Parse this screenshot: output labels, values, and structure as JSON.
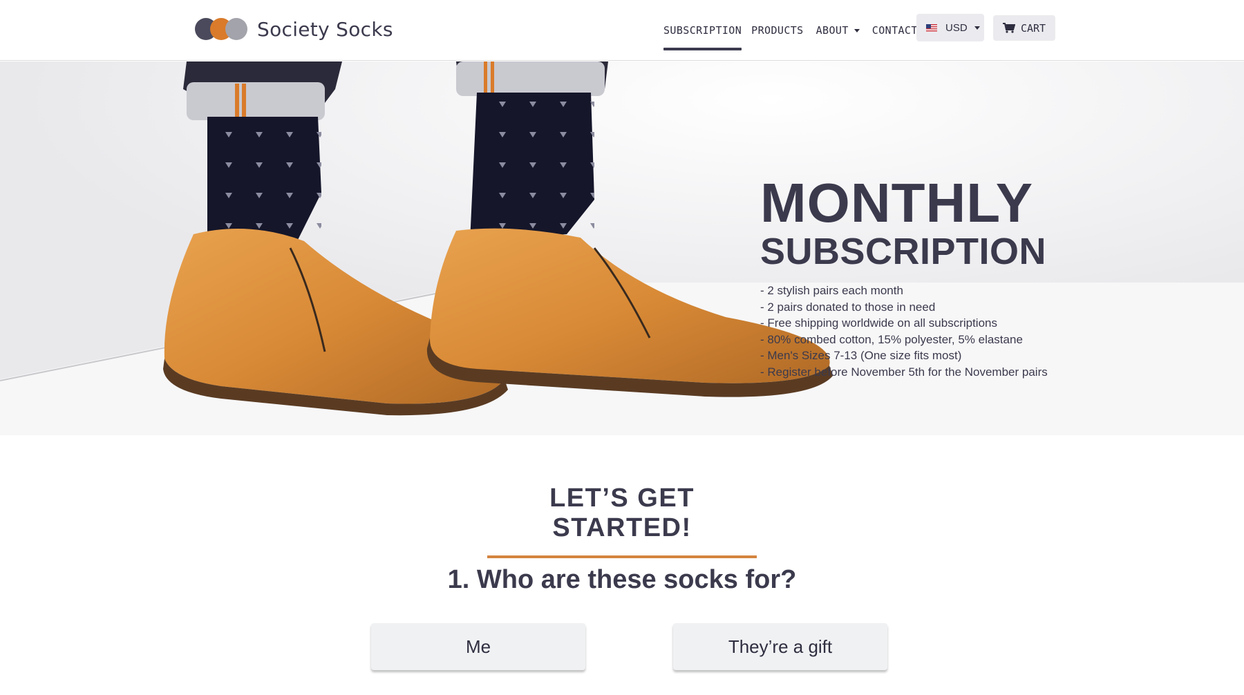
{
  "header": {
    "logo_text": "Society Socks",
    "logo_colors": [
      "#4a4a5c",
      "#d97b2a",
      "#a3a3ab"
    ],
    "nav": {
      "subscription": "SUBSCRIPTION",
      "products": "PRODUCTS",
      "about": "ABOUT",
      "contact": "CONTACT"
    },
    "currency": "USD",
    "currency_icon": "us-flag-icon",
    "cart_label": "CART",
    "cart_icon": "shopping-cart-icon"
  },
  "hero": {
    "title_line1": "MONTHLY",
    "title_line2": "SUBSCRIPTION",
    "features": [
      "- 2 stylish pairs each month",
      "- 2 pairs donated to those in need",
      "- Free shipping worldwide on all subscriptions",
      "- 80% combed cotton, 15% polyester, 5% elastane",
      "- Men's Sizes 7-13 (One size fits most)",
      "- Register before November 5th for the November pairs"
    ]
  },
  "section": {
    "heading": "LET’S GET STARTED!",
    "question": "1. Who are these socks for?",
    "options": [
      "Me",
      "They’re a gift"
    ]
  },
  "colors": {
    "accent": "#d4843f",
    "text": "#3b3a4d",
    "button_bg": "#f0f1f3"
  }
}
